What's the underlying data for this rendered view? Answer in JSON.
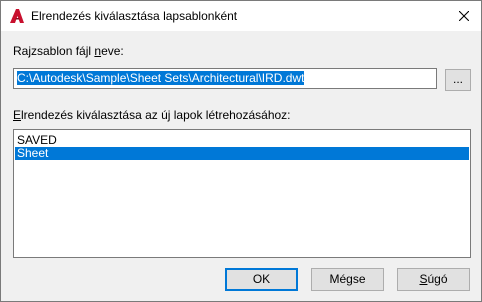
{
  "window": {
    "title": "Elrendezés kiválasztása lapsablonként",
    "app_icon": "autocad-a-icon",
    "close_icon": "close-icon"
  },
  "template_file": {
    "label_prefix": "Rajzsablon fájl ",
    "label_accel": "n",
    "label_suffix": "eve:",
    "value": "C:\\Autodesk\\Sample\\Sheet Sets\\Architectural\\IRD.dwt",
    "browse_label": "..."
  },
  "layouts": {
    "label_accel": "E",
    "label_rest": "lrendezés kiválasztása az új lapok létrehozásához:",
    "items": [
      {
        "label": "SAVED",
        "selected": false
      },
      {
        "label": "Sheet",
        "selected": true
      }
    ]
  },
  "buttons": {
    "ok": "OK",
    "cancel": "Mégse",
    "help_accel": "S",
    "help_rest": "úgó"
  },
  "colors": {
    "selection": "#0078d7",
    "autocad_red": "#c8102e",
    "dialog_bg": "#f0f0f0"
  }
}
